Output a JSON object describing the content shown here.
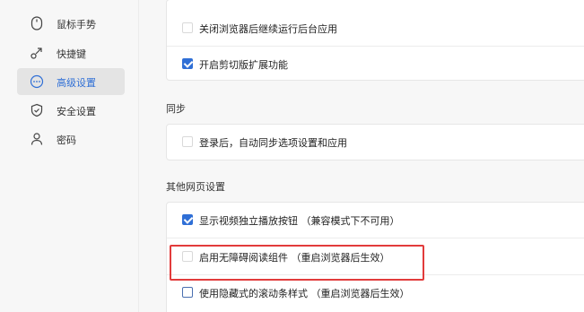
{
  "sidebar": {
    "items": [
      {
        "label": "鼠标手势",
        "icon": "mouse-icon",
        "active": false
      },
      {
        "label": "快捷键",
        "icon": "shortcut-icon",
        "active": false
      },
      {
        "label": "高级设置",
        "icon": "more-icon",
        "active": true
      },
      {
        "label": "安全设置",
        "icon": "shield-icon",
        "active": false
      },
      {
        "label": "密码",
        "icon": "user-icon",
        "active": false
      }
    ]
  },
  "main": {
    "top_card": {
      "rows": [
        {
          "label": "关闭浏览器后继续运行后台应用",
          "checked": false
        },
        {
          "label": "开启剪切版扩展功能",
          "checked": true
        }
      ]
    },
    "sync": {
      "title": "同步",
      "rows": [
        {
          "label": "登录后，自动同步选项设置和应用",
          "checked": false
        }
      ]
    },
    "other": {
      "title": "其他网页设置",
      "rows": [
        {
          "label": "显示视频独立播放按钮 （兼容模式下不可用）",
          "checked": true
        },
        {
          "label": "启用无障碍阅读组件 （重启浏览器后生效）",
          "checked": false
        },
        {
          "label": "使用隐藏式的滚动条样式 （重启浏览器后生效）",
          "checked": false
        }
      ]
    }
  },
  "colors": {
    "accent": "#2f6fd6",
    "highlight": "#e23b3b"
  }
}
